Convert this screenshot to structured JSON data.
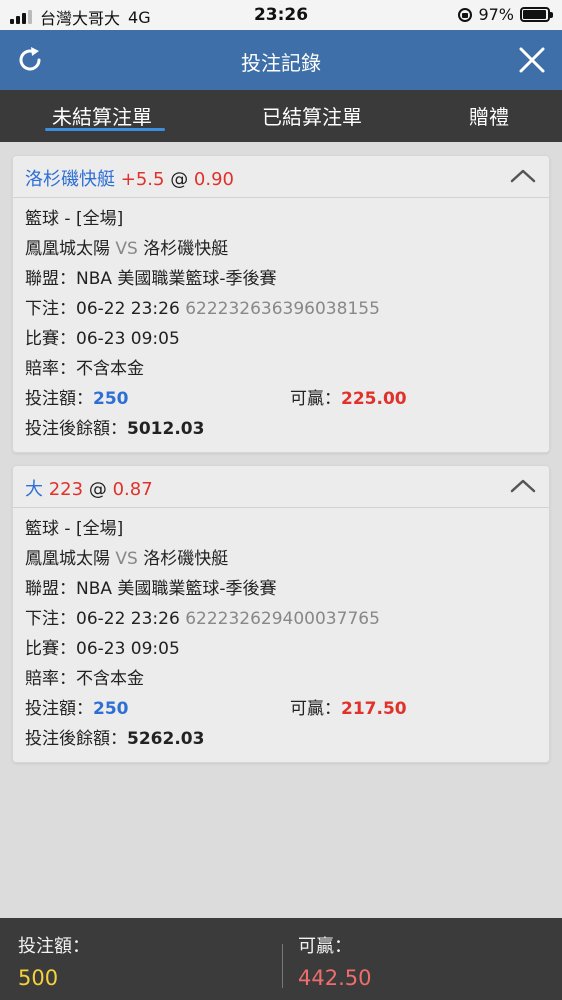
{
  "status_bar": {
    "carrier": "台灣大哥大",
    "network": "4G",
    "time": "23:26",
    "battery": "97%",
    "battery_level": 0.97
  },
  "header": {
    "title": "投注記錄",
    "refresh_icon": "refresh-icon",
    "close_icon": "close-icon",
    "color": "#3e6fa8"
  },
  "tabs": [
    {
      "label": "未結算注單",
      "active": true
    },
    {
      "label": "已結算注單",
      "active": false
    },
    {
      "label": "贈禮",
      "active": false
    }
  ],
  "bets": [
    {
      "selection": "洛杉磯快艇",
      "handicap": "+5.5",
      "at": "@",
      "odds": "0.90",
      "sport": "籃球 - [全場]",
      "home": "鳳凰城太陽",
      "vs": "VS",
      "away": "洛杉磯快艇",
      "league_label": "聯盟：",
      "league": "NBA 美國職業籃球-季後賽",
      "placed_label": "下注：",
      "placed_time": "06-22 23:26",
      "ticket_id": "622232636396038155",
      "match_label": "比賽：",
      "match_time": "06-23 09:05",
      "odds_type_label": "賠率：",
      "odds_type": "不含本金",
      "stake_label": "投注額：",
      "stake": "250",
      "win_label": "可贏：",
      "win": "225.00",
      "balance_label": "投注後餘額：",
      "balance": "5012.03"
    },
    {
      "selection": "大",
      "handicap": "223",
      "at": "@",
      "odds": "0.87",
      "sport": "籃球 - [全場]",
      "home": "鳳凰城太陽",
      "vs": "VS",
      "away": "洛杉磯快艇",
      "league_label": "聯盟：",
      "league": "NBA 美國職業籃球-季後賽",
      "placed_label": "下注：",
      "placed_time": "06-22 23:26",
      "ticket_id": "622232629400037765",
      "match_label": "比賽：",
      "match_time": "06-23 09:05",
      "odds_type_label": "賠率：",
      "odds_type": "不含本金",
      "stake_label": "投注額：",
      "stake": "250",
      "win_label": "可贏：",
      "win": "217.50",
      "balance_label": "投注後餘額：",
      "balance": "5262.03"
    }
  ],
  "footer": {
    "stake_label": "投注額：",
    "stake_total": "500",
    "win_label": "可贏：",
    "win_total": "442.50"
  },
  "colors": {
    "accent_blue": "#2e6fd6",
    "odds_red": "#e0322b",
    "tab_underline": "#3b8fe0",
    "footer_yellow": "#f3d23b"
  }
}
